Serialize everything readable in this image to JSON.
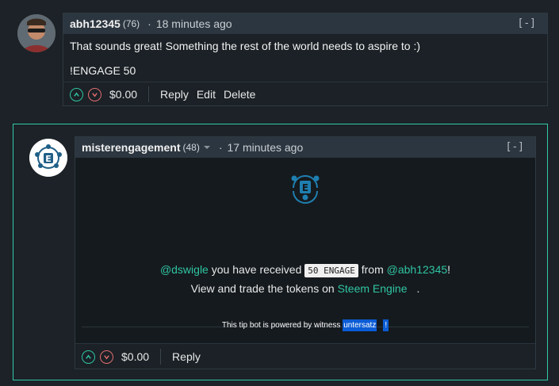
{
  "comment1": {
    "author": "abh12345",
    "reputation": "(76)",
    "time": "18 minutes ago",
    "collapse": "[-]",
    "lines": [
      "That sounds great! Something the rest of the world needs to aspire to :)",
      "!ENGAGE 50"
    ],
    "payout": "$0.00",
    "actions": [
      "Reply",
      "Edit",
      "Delete"
    ]
  },
  "comment2": {
    "author": "misterengagement",
    "reputation": "(48)",
    "time": "17 minutes ago",
    "collapse": "[-]",
    "recipient": "@dswigle",
    "text1": " you have received ",
    "amount_code": "50 ENGAGE",
    "text2": " from ",
    "sender": "@abh12345",
    "text3": "!",
    "line2_prefix": "View and trade the tokens on ",
    "line2_link": "Steem Engine",
    "line2_suffix": ".",
    "powered_prefix": "This tip bot is powered by witness ",
    "powered_link": "untersatz",
    "powered_suffix": "!",
    "payout": "$0.00",
    "action": "Reply"
  },
  "colors": {
    "accent": "#2fc5a2",
    "downvote": "#e06d6d",
    "header_bg": "#2c3640",
    "page_bg": "#1c2227",
    "selection": "#0b5cd5"
  }
}
